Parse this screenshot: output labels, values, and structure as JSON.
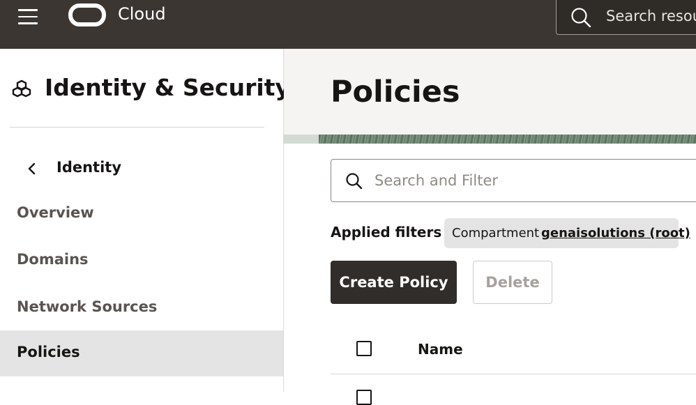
{
  "topbar": {
    "brand": "Cloud",
    "search_placeholder": "Search resou"
  },
  "sidebar": {
    "section_title": "Identity & Security",
    "back_label": "Identity",
    "items": [
      {
        "label": "Overview"
      },
      {
        "label": "Domains"
      },
      {
        "label": "Network Sources"
      },
      {
        "label": "Policies",
        "active": true
      }
    ]
  },
  "main": {
    "title": "Policies",
    "filter_placeholder": "Search and Filter",
    "applied_filters_label": "Applied filters",
    "chip": {
      "key": "Compartment",
      "value": "genaisolutions (root)"
    },
    "buttons": {
      "create": "Create Policy",
      "delete": "Delete"
    },
    "table": {
      "columns": [
        "Name"
      ]
    }
  },
  "colors": {
    "topbar": "#3b3631",
    "primary_button": "#312d2a",
    "active_nav": "#e4e4e4"
  }
}
